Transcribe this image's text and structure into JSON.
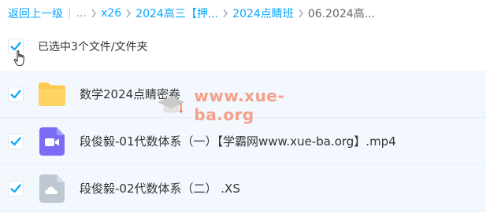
{
  "breadcrumb": {
    "back_label": "返回上一级",
    "ellipsis": "...",
    "items": [
      {
        "label": "x26"
      },
      {
        "label": "2024高三【押..."
      },
      {
        "label": "2024点睛班"
      },
      {
        "label": "06.2024高..."
      }
    ]
  },
  "selection": {
    "label": "已选中3个文件/文件夹"
  },
  "files": [
    {
      "name": "数学2024点睛密卷",
      "type": "folder",
      "icon": "folder-icon",
      "checked": true
    },
    {
      "name": "段俊毅-01代数体系（一）【学霸网www.xue-ba.org】.mp4",
      "type": "video",
      "icon": "video-file-icon",
      "checked": true
    },
    {
      "name": "段俊毅-02代数体系（二） .XS",
      "type": "unknown",
      "icon": "cloud-file-icon",
      "checked": true
    }
  ],
  "watermark": {
    "text": "www.xue-ba.org"
  },
  "colors": {
    "accent": "#06a7ff",
    "row_bg": "#f2f8fe",
    "folder": "#ffc94d",
    "video": "#7b6cf6",
    "unknown": "#bfc8d2",
    "check": "#06a7ff"
  }
}
